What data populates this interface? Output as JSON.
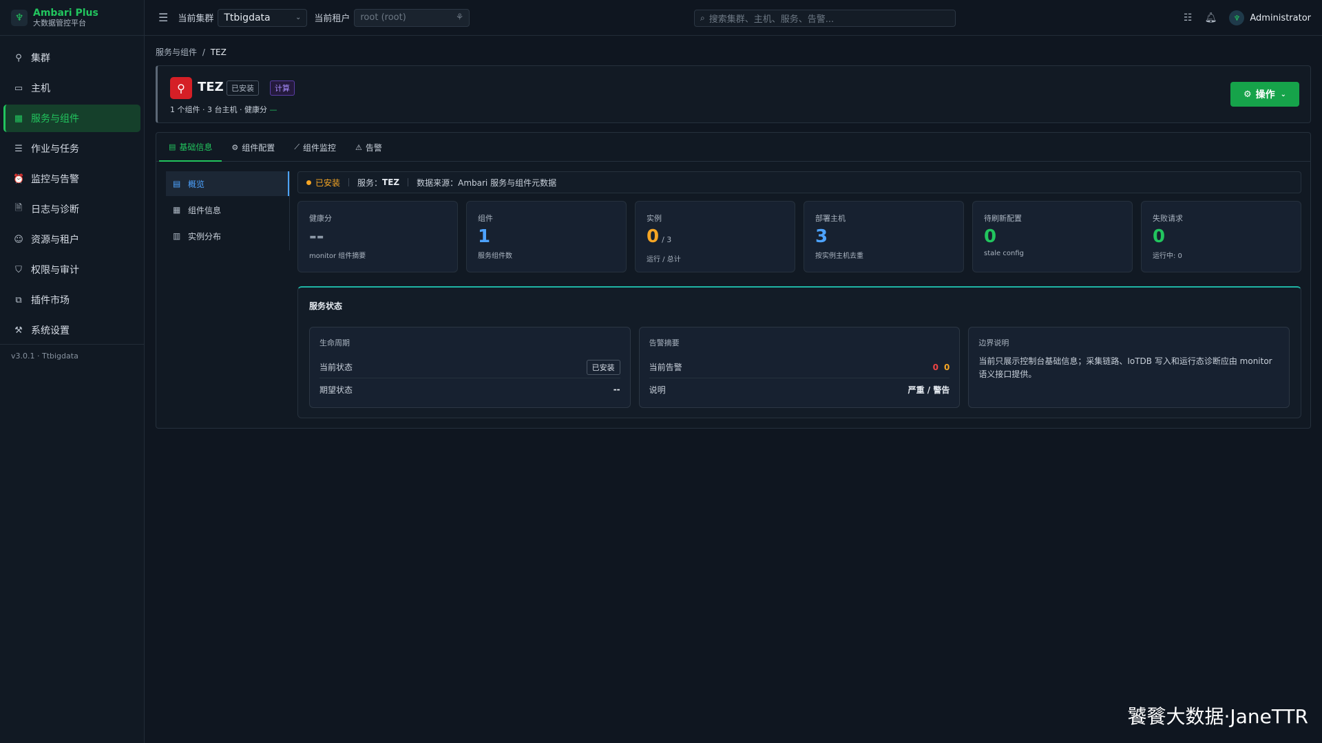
{
  "brand": {
    "title": "Ambari Plus",
    "subtitle": "大数据管控平台"
  },
  "nav": [
    {
      "label": "集群",
      "icon": "rocket-icon",
      "glyph": "⚲"
    },
    {
      "label": "主机",
      "icon": "monitor-icon",
      "glyph": "▭"
    },
    {
      "label": "服务与组件",
      "icon": "grid-icon",
      "glyph": "▦"
    },
    {
      "label": "作业与任务",
      "icon": "list-icon",
      "glyph": "☰"
    },
    {
      "label": "监控与告警",
      "icon": "siren-icon",
      "glyph": "⏰"
    },
    {
      "label": "日志与诊断",
      "icon": "log-icon",
      "glyph": "🗎"
    },
    {
      "label": "资源与租户",
      "icon": "users-icon",
      "glyph": "☺"
    },
    {
      "label": "权限与审计",
      "icon": "shield-icon",
      "glyph": "⛉"
    },
    {
      "label": "插件市场",
      "icon": "plugin-icon",
      "glyph": "⧉"
    },
    {
      "label": "系统设置",
      "icon": "wrench-icon",
      "glyph": "⚒"
    }
  ],
  "version": "v3.0.1 · Ttbigdata",
  "topbar": {
    "cluster_label": "当前集群",
    "cluster_value": "Ttbigdata",
    "tenant_label": "当前租户",
    "tenant_placeholder": "root (root)",
    "search_placeholder": "搜索集群、主机、服务、告警...",
    "user": "Administrator"
  },
  "breadcrumb": {
    "parent": "服务与组件",
    "sep": "/",
    "current": "TEZ"
  },
  "service": {
    "name": "TEZ",
    "installed_badge": "已安装",
    "category_badge": "计算",
    "meta": "1 个组件 · 3 台主机 · 健康分",
    "meta_health": "—",
    "ops_label": "操作"
  },
  "tabs": [
    {
      "label": "基础信息",
      "icon": "info-icon",
      "glyph": "▤"
    },
    {
      "label": "组件配置",
      "icon": "gear-icon",
      "glyph": "⚙"
    },
    {
      "label": "组件监控",
      "icon": "chart-icon",
      "glyph": "⟋"
    },
    {
      "label": "告警",
      "icon": "warning-icon",
      "glyph": "⚠"
    }
  ],
  "subnav": [
    {
      "label": "概览",
      "icon": "overview-icon",
      "glyph": "▤"
    },
    {
      "label": "组件信息",
      "icon": "component-icon",
      "glyph": "▦"
    },
    {
      "label": "实例分布",
      "icon": "distribution-icon",
      "glyph": "▥"
    }
  ],
  "statusbar": {
    "state": "已安装",
    "service_label": "服务：",
    "service_value": "TEZ",
    "source": "数据来源：Ambari 服务与组件元数据"
  },
  "kpis": [
    {
      "label": "健康分",
      "value": "--",
      "sub": "monitor 组件摘要",
      "color": "#8d99a8"
    },
    {
      "label": "组件",
      "value": "1",
      "sub": "服务组件数",
      "color": "#4da3ff"
    },
    {
      "label": "实例",
      "value": "0",
      "of": "/ 3",
      "sub": "运行 / 总计",
      "color": "#f5a524"
    },
    {
      "label": "部署主机",
      "value": "3",
      "sub": "按实例主机去重",
      "color": "#4da3ff"
    },
    {
      "label": "待刷新配置",
      "value": "0",
      "sub": "stale config",
      "color": "#22c55e"
    },
    {
      "label": "失败请求",
      "value": "0",
      "sub": "运行中: 0",
      "color": "#22c55e"
    }
  ],
  "service_status": {
    "title": "服务状态",
    "lifecycle": {
      "title": "生命周期",
      "current_label": "当前状态",
      "current_value": "已安装",
      "expected_label": "期望状态",
      "expected_value": "--"
    },
    "alerts": {
      "title": "告警摘要",
      "current_label": "当前告警",
      "critical": "0",
      "warning": "0",
      "note_label": "说明",
      "note_value": "严重 / 警告"
    },
    "boundary": {
      "title": "边界说明",
      "text": "当前只展示控制台基础信息；采集链路、IoTDB 写入和运行态诊断应由 monitor 语义接口提供。"
    }
  },
  "watermark": "饕餮大数据·JaneTTR"
}
